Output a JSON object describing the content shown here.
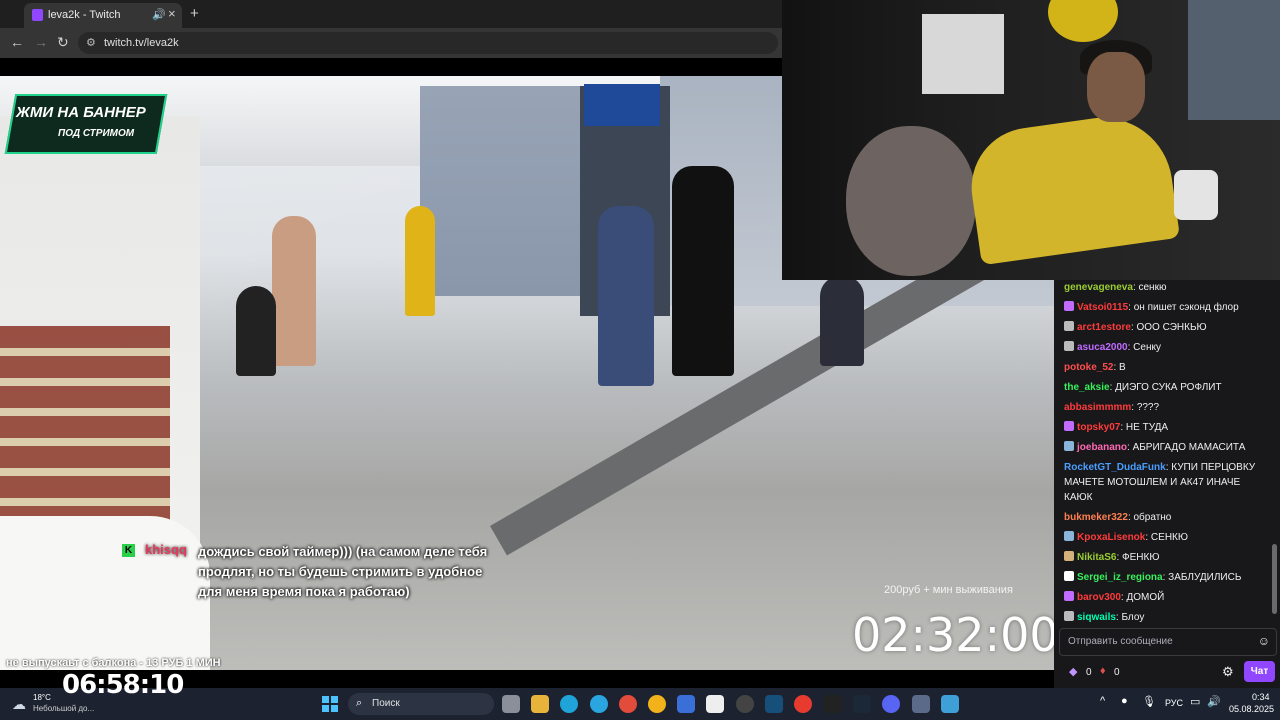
{
  "browser": {
    "tab_title": "leva2k - Twitch",
    "url": "twitch.tv/leva2k"
  },
  "overlay": {
    "banner_line1": "ЖМИ НА БАННЕР",
    "banner_line2": "ПОД СТРИМОМ",
    "chat_badge": "K",
    "chat_user": "khisqq",
    "chat_text": "дождись свой таймер))) (на самом деле тебя продлят, но ты будешь стримить в удобное для меня время пока я работаю)",
    "timer_label": "200руб + мин выживания",
    "timer_value": "02:32:00",
    "ticker": "не выпускаьт с балкона - 13 РУБ 1 МИН",
    "clock": "06:58:10"
  },
  "chat": {
    "messages": [
      {
        "user": "genevageneva",
        "text": "сенкю",
        "color": "#9acd32",
        "badge": ""
      },
      {
        "user": "Vatsoi0115",
        "text": "он пишет сэконд флор",
        "color": "#ff3b3b",
        "badge": "#c16cff"
      },
      {
        "user": "arct1estore",
        "text": "ООО СЭНКЬЮ",
        "color": "#ff3b3b",
        "badge": "#bbbbbb"
      },
      {
        "user": "asuca2000",
        "text": "Сенку",
        "color": "#c16cff",
        "badge": "#bbbbbb"
      },
      {
        "user": "potoke_52",
        "text": "В",
        "color": "#ff4d4d",
        "badge": ""
      },
      {
        "user": "the_aksie",
        "text": "ДИЭГО СУКА РОФЛИТ",
        "color": "#38f05a",
        "badge": ""
      },
      {
        "user": "abbasimmmm",
        "text": "????",
        "color": "#ff3b3b",
        "badge": ""
      },
      {
        "user": "topsky07",
        "text": "НЕ ТУДА",
        "color": "#ff3b3b",
        "badge": "#c16cff"
      },
      {
        "user": "joebanano",
        "text": "АБРИГАДО МАМАСИТА",
        "color": "#ff69b4",
        "badge": "#8ab4d9"
      },
      {
        "user": "RocketGT_DudaFunk",
        "text": "КУПИ ПЕРЦОВКУ МАЧЕТЕ МОТОШЛЕМ И АК47 ИНАЧЕ КАЮК",
        "color": "#4a9eff",
        "badge": ""
      },
      {
        "user": "bukmeker322",
        "text": "обратно",
        "color": "#ff7f50",
        "badge": ""
      },
      {
        "user": "KpoxaLisenok",
        "text": "СЕНКЮ",
        "color": "#ff3b3b",
        "badge": "#8ab4d9"
      },
      {
        "user": "NikitaS6",
        "text": "ФЕНКЮ",
        "color": "#9acd32",
        "badge": "#d4b07a"
      },
      {
        "user": "Sergei_iz_regiona",
        "text": "ЗАБЛУДИЛИСЬ",
        "color": "#38f05a",
        "badge": "#ffffff"
      },
      {
        "user": "barov300",
        "text": "ДОМОЙ",
        "color": "#ff3b3b",
        "badge": "#c16cff"
      },
      {
        "user": "siqwails",
        "text": "Блоу",
        "color": "#00ffb0",
        "badge": "#bbbbbb"
      }
    ],
    "input_placeholder": "Отправить сообщение",
    "points": "0",
    "bits": "0",
    "chat_button": "Чат"
  },
  "taskbar": {
    "weather_temp": "18°C",
    "weather_desc": "Небольшой до...",
    "search_placeholder": "Поиск",
    "language": "РУС",
    "time": "0:34",
    "date": "05.08.2025"
  }
}
